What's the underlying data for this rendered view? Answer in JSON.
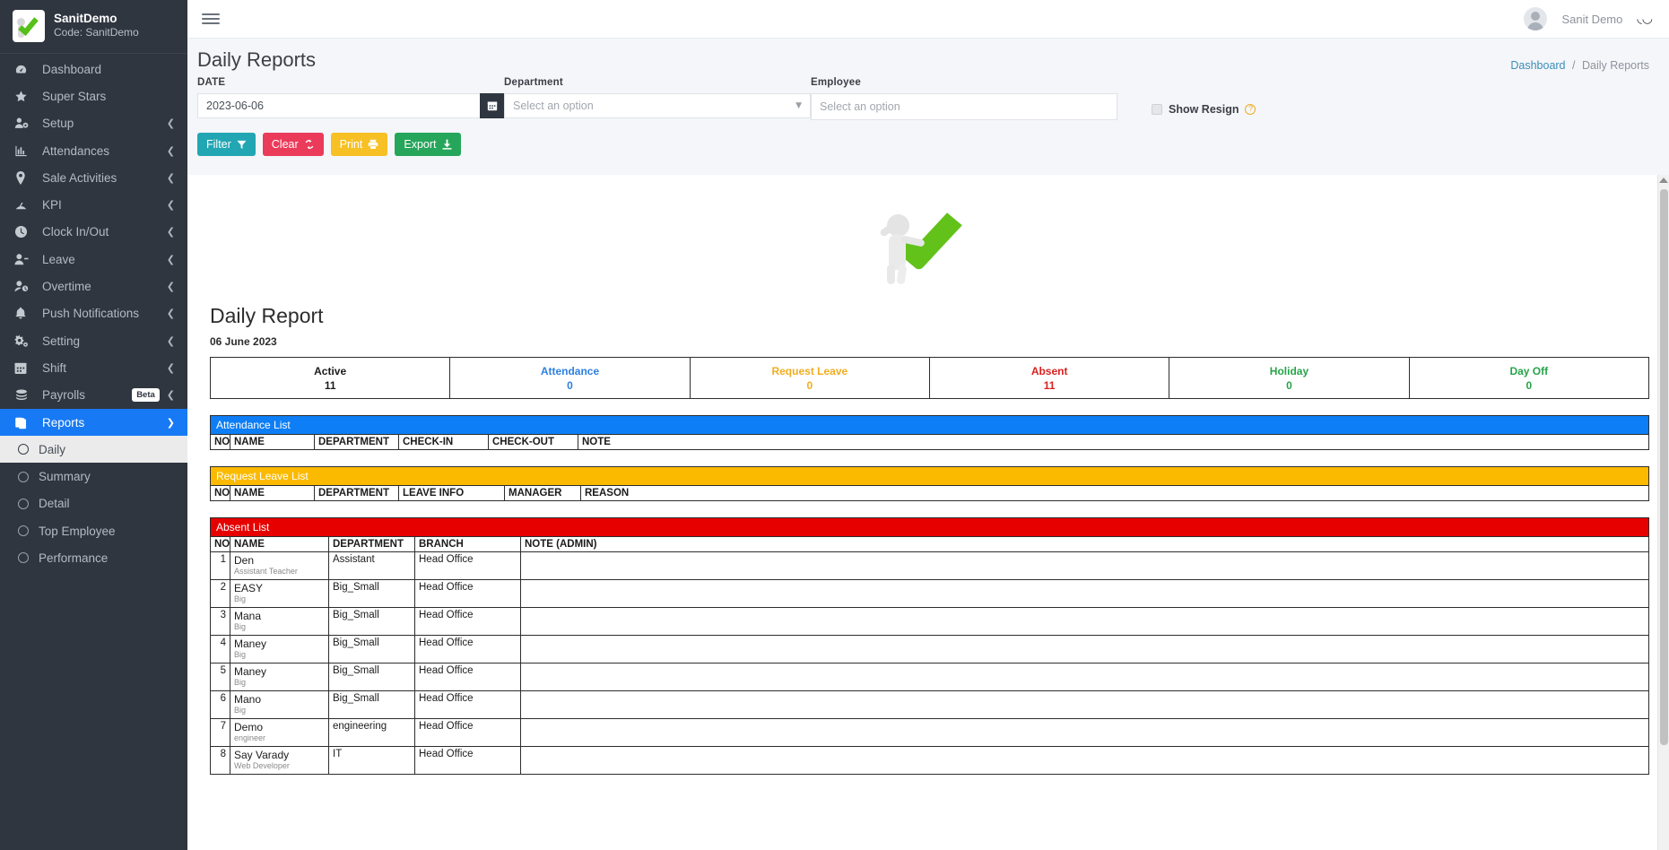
{
  "brand": {
    "title": "SanitDemo",
    "code": "Code: SanitDemo"
  },
  "sidebar": {
    "items": [
      {
        "label": "Dashboard",
        "icon": "dashboard-icon",
        "caret": false
      },
      {
        "label": "Super Stars",
        "icon": "star-icon",
        "caret": false
      },
      {
        "label": "Setup",
        "icon": "user-gear-icon",
        "caret": true
      },
      {
        "label": "Attendances",
        "icon": "bar-chart-icon",
        "caret": true
      },
      {
        "label": "Sale Activities",
        "icon": "map-pin-icon",
        "caret": true
      },
      {
        "label": "KPI",
        "icon": "kpi-icon",
        "caret": true
      },
      {
        "label": "Clock In/Out",
        "icon": "clock-icon",
        "caret": true
      },
      {
        "label": "Leave",
        "icon": "user-minus-icon",
        "caret": true
      },
      {
        "label": "Overtime",
        "icon": "user-clock-icon",
        "caret": true
      },
      {
        "label": "Push Notifications",
        "icon": "bell-icon",
        "caret": true
      },
      {
        "label": "Setting",
        "icon": "gears-icon",
        "caret": true
      },
      {
        "label": "Shift",
        "icon": "calendar-icon",
        "caret": true
      },
      {
        "label": "Payrolls",
        "icon": "money-stack-icon",
        "caret": true,
        "badge": "Beta"
      },
      {
        "label": "Reports",
        "icon": "clipboard-icon",
        "caret": true,
        "active": true,
        "expanded": true
      }
    ],
    "reports_sub": [
      {
        "label": "Daily",
        "active": true
      },
      {
        "label": "Summary",
        "active": false
      },
      {
        "label": "Detail",
        "active": false
      },
      {
        "label": "Top Employee",
        "active": false
      },
      {
        "label": "Performance",
        "active": false
      }
    ]
  },
  "topbar": {
    "user_name": "Sanit Demo"
  },
  "page": {
    "title": "Daily Reports",
    "breadcrumb_root": "Dashboard",
    "breadcrumb_sep": "/",
    "breadcrumb_current": "Daily Reports"
  },
  "filters": {
    "date_label": "DATE",
    "date_value": "2023-06-06",
    "department_label": "Department",
    "department_value": "Select an option",
    "employee_label": "Employee",
    "employee_placeholder": "Select an option",
    "show_resign_label": "Show Resign",
    "help_glyph": "?"
  },
  "buttons": {
    "filter": "Filter",
    "clear": "Clear",
    "print": "Print",
    "export": "Export"
  },
  "report": {
    "heading": "Daily Report",
    "date": "06 June 2023",
    "stats": [
      {
        "label": "Active",
        "value": "11",
        "color": "#1c1c1c"
      },
      {
        "label": "Attendance",
        "value": "0",
        "color": "#2d7fe0"
      },
      {
        "label": "Request Leave",
        "value": "0",
        "color": "#f0ad20"
      },
      {
        "label": "Absent",
        "value": "11",
        "color": "#d9201f"
      },
      {
        "label": "Holiday",
        "value": "0",
        "color": "#27a44a"
      },
      {
        "label": "Day Off",
        "value": "0",
        "color": "#27a44a"
      }
    ],
    "attendance_list": {
      "caption": "Attendance List",
      "caption_bg": "#0d7ef5",
      "columns": [
        "NO",
        "NAME",
        "DEPARTMENT",
        "CHECK-IN",
        "CHECK-OUT",
        "NOTE"
      ],
      "rows": []
    },
    "request_leave_list": {
      "caption": "Request Leave List",
      "caption_bg": "#fbba00",
      "columns": [
        "NO",
        "NAME",
        "DEPARTMENT",
        "LEAVE INFO",
        "MANAGER",
        "REASON"
      ],
      "rows": []
    },
    "absent_list": {
      "caption": "Absent List",
      "caption_bg": "#e60000",
      "columns": [
        "NO",
        "NAME",
        "DEPARTMENT",
        "BRANCH",
        "NOTE (ADMIN)"
      ],
      "rows": [
        {
          "no": "1",
          "name": "Den",
          "position": "Assistant Teacher",
          "department": "Assistant",
          "branch": "Head Office",
          "note": ""
        },
        {
          "no": "2",
          "name": "EASY",
          "position": "Big",
          "department": "Big_Small",
          "branch": "Head Office",
          "note": ""
        },
        {
          "no": "3",
          "name": "Mana",
          "position": "Big",
          "department": "Big_Small",
          "branch": "Head Office",
          "note": ""
        },
        {
          "no": "4",
          "name": "Maney",
          "position": "Big",
          "department": "Big_Small",
          "branch": "Head Office",
          "note": ""
        },
        {
          "no": "5",
          "name": "Maney",
          "position": "Big",
          "department": "Big_Small",
          "branch": "Head Office",
          "note": ""
        },
        {
          "no": "6",
          "name": "Mano",
          "position": "Big",
          "department": "Big_Small",
          "branch": "Head Office",
          "note": ""
        },
        {
          "no": "7",
          "name": "Demo",
          "position": "engineer",
          "department": "engineering",
          "branch": "Head Office",
          "note": ""
        },
        {
          "no": "8",
          "name": "Say Varady",
          "position": "Web Developer",
          "department": "IT",
          "branch": "Head Office",
          "note": ""
        }
      ]
    }
  }
}
